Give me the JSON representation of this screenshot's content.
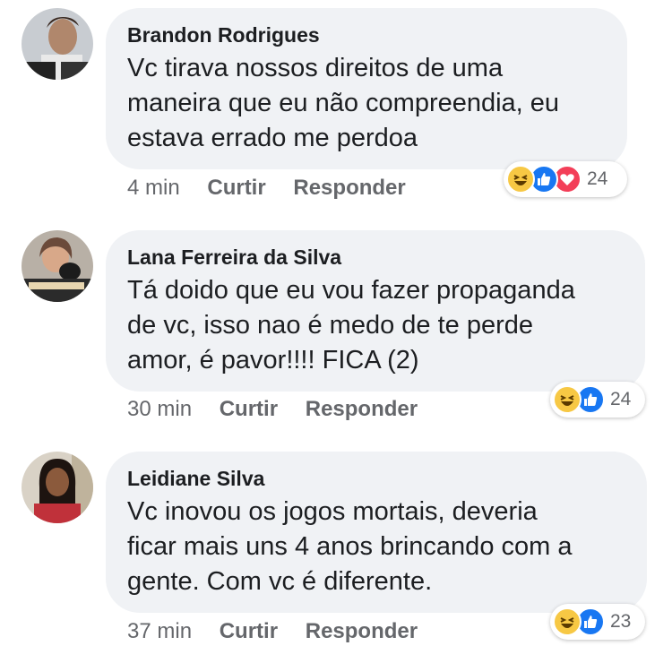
{
  "actions": {
    "like": "Curtir",
    "reply": "Responder"
  },
  "comments": [
    {
      "author": "Brandon Rodrigues",
      "lines": [
        "Vc tirava nossos direitos de uma",
        "maneira que eu não compreendia, eu",
        "estava errado me perdoa"
      ],
      "time": "4 min",
      "reactions": [
        "haha-icon",
        "like-icon",
        "love-icon"
      ],
      "reaction_count": "24"
    },
    {
      "author": "Lana Ferreira da Silva",
      "lines": [
        "Tá doido que eu vou fazer propaganda",
        "de vc, isso nao é medo de te perde",
        "amor, é pavor!!!! FICA (2)"
      ],
      "time": "30 min",
      "reactions": [
        "haha-icon",
        "like-icon"
      ],
      "reaction_count": "24"
    },
    {
      "author": "Leidiane Silva",
      "lines": [
        "Vc inovou os jogos mortais, deveria",
        "ficar mais uns 4 anos brincando com a",
        "gente. Com vc é diferente."
      ],
      "time": "37 min",
      "reactions": [
        "haha-icon",
        "like-icon"
      ],
      "reaction_count": "23"
    }
  ],
  "colors": {
    "bubble": "#f0f2f5",
    "meta": "#65676b",
    "like": "#1877f2",
    "love": "#f33e58",
    "haha": "#f7c844"
  }
}
